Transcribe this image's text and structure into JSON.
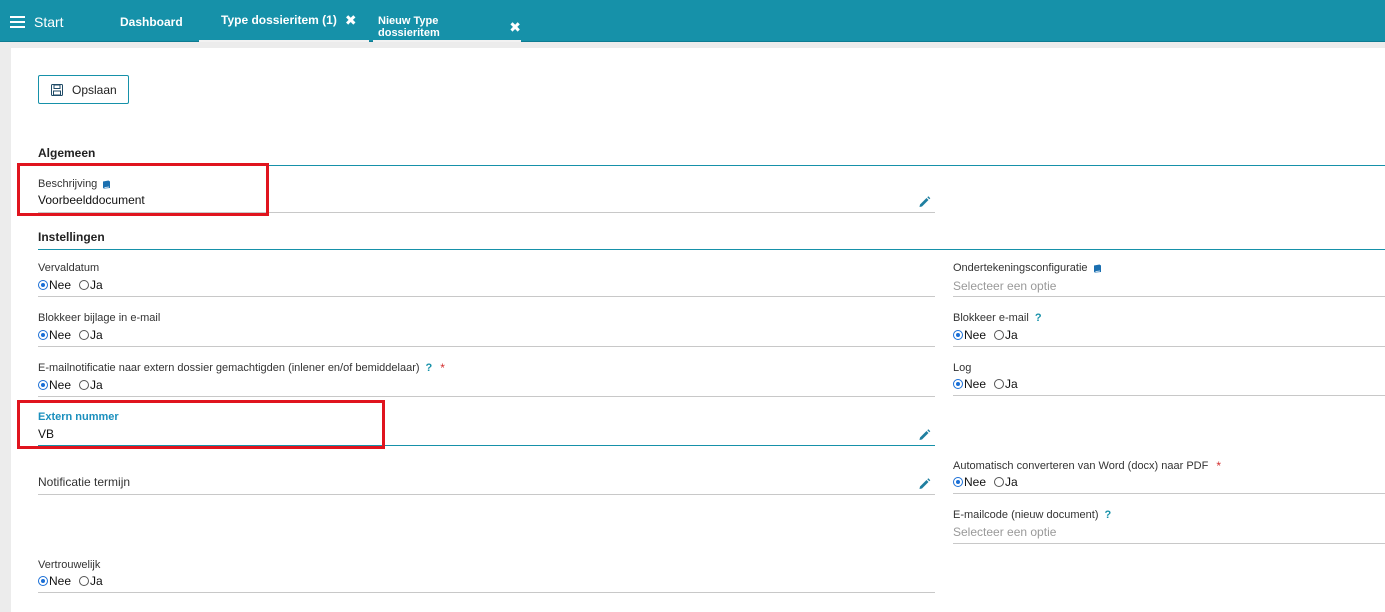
{
  "topbar": {
    "menu_label": "Start",
    "tabs": [
      {
        "label": "Dashboard",
        "closable": false
      },
      {
        "label": "Type dossieritem (1)",
        "closable": true
      },
      {
        "label": "Nieuw Type dossieritem",
        "closable": true
      }
    ],
    "close_glyph": "✖"
  },
  "toolbar": {
    "save_label": "Opslaan"
  },
  "sections": {
    "general": "Algemeen",
    "settings": "Instellingen"
  },
  "fields": {
    "beschrijving": {
      "label": "Beschrijving",
      "value": "Voorbeelddocument"
    },
    "vervaldatum": {
      "label": "Vervaldatum",
      "options": [
        "Nee",
        "Ja"
      ],
      "selected": "Nee"
    },
    "blokkeer_bijlage": {
      "label": "Blokkeer bijlage in e-mail",
      "options": [
        "Nee",
        "Ja"
      ],
      "selected": "Nee"
    },
    "emailnotificatie": {
      "label": "E-mailnotificatie naar extern dossier gemachtigden (inlener en/of bemiddelaar)",
      "help": "?",
      "required": "*",
      "options": [
        "Nee",
        "Ja"
      ],
      "selected": "Nee"
    },
    "extern_nummer": {
      "label": "Extern nummer",
      "value": "VB"
    },
    "notificatie_termijn": {
      "label": "Notificatie termijn"
    },
    "vertrouwelijk": {
      "label": "Vertrouwelijk",
      "options": [
        "Nee",
        "Ja"
      ],
      "selected": "Nee"
    },
    "ondertekening": {
      "label": "Ondertekeningsconfiguratie",
      "placeholder": "Selecteer een optie"
    },
    "blokkeer_email": {
      "label": "Blokkeer e-mail",
      "help": "?",
      "options": [
        "Nee",
        "Ja"
      ],
      "selected": "Nee"
    },
    "log": {
      "label": "Log",
      "options": [
        "Nee",
        "Ja"
      ],
      "selected": "Nee"
    },
    "auto_convert": {
      "label": "Automatisch converteren van Word (docx) naar PDF",
      "required": "*",
      "options": [
        "Nee",
        "Ja"
      ],
      "selected": "Nee"
    },
    "emailcode": {
      "label": "E-mailcode (nieuw document)",
      "help": "?",
      "placeholder": "Selecteer een optie"
    }
  },
  "colors": {
    "brand": "#1691a9",
    "highlight": "#e0141e",
    "required": "#d32f2f",
    "radio_selected": "#1a6fd6"
  }
}
